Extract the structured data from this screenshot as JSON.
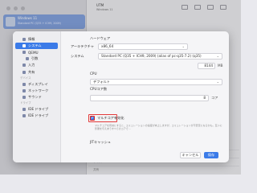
{
  "background": {
    "app_title": "UTM",
    "app_subtitle": "Windows 11",
    "vm": {
      "name": "Windows 11",
      "os": "Standard PC (Q35 + ICH9, 2009)"
    },
    "list_rows": [
      {
        "label": "メモリ",
        "value": ""
      },
      {
        "label": "サイズ",
        "value": ""
      },
      {
        "label": "共有",
        "value": ""
      }
    ]
  },
  "sidebar": {
    "items": [
      {
        "label": "情報",
        "active": false,
        "sub": false
      },
      {
        "label": "システム",
        "active": true,
        "sub": false
      },
      {
        "label": "QEMU",
        "active": false,
        "sub": false
      },
      {
        "label": "引数",
        "active": false,
        "sub": true
      },
      {
        "label": "入力",
        "active": false,
        "sub": false
      },
      {
        "label": "共有",
        "active": false,
        "sub": false
      }
    ],
    "devices_header": "デバイス",
    "device_items": [
      {
        "label": "ディスプレイ",
        "sub": false
      },
      {
        "label": "ネットワーク",
        "sub": false
      },
      {
        "label": "サウンド",
        "sub": false
      }
    ],
    "drives_header": "ドライブ",
    "drive_items": [
      {
        "label": "IDE ドライブ"
      },
      {
        "label": "IDE ドライブ"
      }
    ]
  },
  "content": {
    "hardware_header": "ハードウェア",
    "architecture_label": "アーキテクチャ",
    "architecture_value": "x86_64",
    "system_label": "システム",
    "system_value": "Standard PC (Q35 + ICH9, 2009) (alias of pc-q35-7.2) (q35)",
    "memory_value": "8144",
    "memory_unit": "MB",
    "cpu_header": "CPU",
    "cpu_value": "デフォルト",
    "cpu_cores_label": "CPUコア数",
    "cpu_cores_value": "8",
    "cpu_cores_unit": "コア",
    "multicore_label": "マルチコア有効化",
    "multicore_help": "マルチコアを有効にすると、エミュレーションの速度が向上しますが、エミュレーションが不安定になるかも。互いに影響を与えあうすべてのコアで…",
    "jit_label": "JITキャッシュ"
  },
  "buttons": {
    "cancel": "キャンセル",
    "save": "保存"
  },
  "colors": {
    "accent": "#3b7be8",
    "highlight_border": "#e23b3b"
  }
}
